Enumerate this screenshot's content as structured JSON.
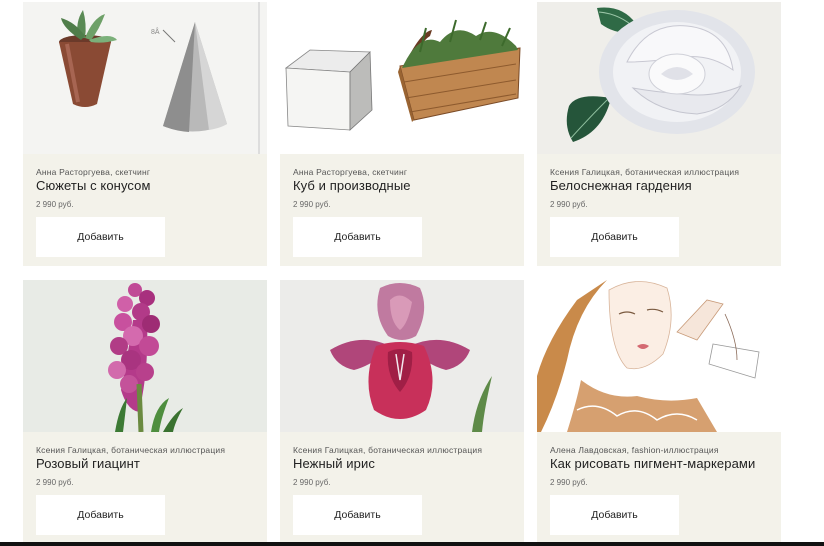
{
  "products": [
    {
      "author": "Анна Расторгуева, скетчинг",
      "title": "Сюжеты с конусом",
      "price": "2 990 руб.",
      "button": "Добавить",
      "image": "cone-flowerpot-sketch"
    },
    {
      "author": "Анна Расторгуева, скетчинг",
      "title": "Куб и производные",
      "price": "2 990 руб.",
      "button": "Добавить",
      "image": "cube-planter-sketch"
    },
    {
      "author": "Ксения Галицкая, ботаническая иллюстрация",
      "title": "Белоснежная гардения",
      "price": "2 990 руб.",
      "button": "Добавить",
      "image": "white-gardenia-illustration"
    },
    {
      "author": "Ксения Галицкая, ботаническая иллюстрация",
      "title": "Розовый гиацинт",
      "price": "2 990 руб.",
      "button": "Добавить",
      "image": "pink-hyacinth-illustration"
    },
    {
      "author": "Ксения Галицкая, ботаническая иллюстрация",
      "title": "Нежный ирис",
      "price": "2 990 руб.",
      "button": "Добавить",
      "image": "pink-iris-illustration"
    },
    {
      "author": "Алена Лавдовская, fashion-иллюстрация",
      "title": "Как рисовать пигмент-маркерами",
      "price": "2 990 руб.",
      "button": "Добавить",
      "image": "fashion-portrait-illustration"
    }
  ],
  "colors": {
    "card_bg": "#f3f2ea",
    "button_bg": "#ffffff",
    "text": "#222222"
  }
}
